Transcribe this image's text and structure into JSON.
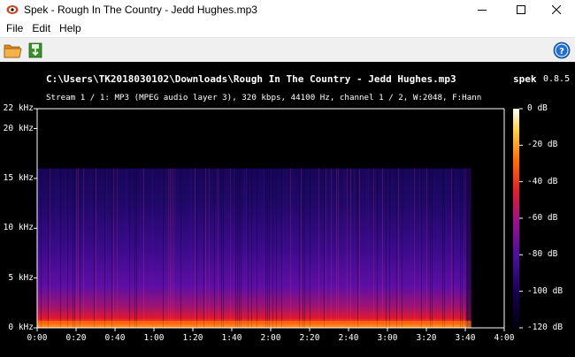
{
  "window": {
    "title": "Spek - Rough In The Country - Jedd Hughes.mp3",
    "minimize_icon": "minimize-icon",
    "maximize_icon": "maximize-icon",
    "close_icon": "close-icon"
  },
  "menu": {
    "items": [
      "File",
      "Edit",
      "Help"
    ]
  },
  "toolbar": {
    "open_icon": "folder-open-icon",
    "save_icon": "save-image-icon",
    "help_icon": "help-icon"
  },
  "spectrogram": {
    "file_path": "C:\\Users\\TK2018030102\\Downloads\\Rough In The Country - Jedd Hughes.mp3",
    "app_name": "spek",
    "app_version": "0.8.5",
    "stream_info": "Stream 1 / 1: MP3 (MPEG audio layer 3), 320 kbps, 44100 Hz, channel 1 / 2, W:2048, F:Hann"
  },
  "chart_data": {
    "type": "heatmap",
    "title": "",
    "xlabel": "",
    "ylabel": "",
    "x_ticks": [
      "0:00",
      "0:20",
      "0:40",
      "1:00",
      "1:20",
      "1:40",
      "2:00",
      "2:20",
      "2:40",
      "3:00",
      "3:20",
      "3:40",
      "4:00"
    ],
    "x_range_seconds": [
      0,
      240
    ],
    "y_ticks": [
      "0 kHz",
      "5 kHz",
      "10 kHz",
      "15 kHz",
      "20 kHz",
      "22 kHz"
    ],
    "y_range_khz": [
      0,
      22
    ],
    "color_scale_ticks": [
      "0 dB",
      "-20 dB",
      "-40 dB",
      "-60 dB",
      "-80 dB",
      "-100 dB",
      "-120 dB"
    ],
    "color_scale_range_db": [
      -120,
      0
    ],
    "audio_end_seconds": 223,
    "frequency_cutoff_khz": 16,
    "colors": {
      "background": "#000000",
      "low": "#050018",
      "mid_low": "#2a0a6e",
      "mid": "#6a13a0",
      "mid_high": "#c0204a",
      "high": "#ff5a0a",
      "peak": "#ffee60",
      "max": "#ffffff"
    }
  }
}
